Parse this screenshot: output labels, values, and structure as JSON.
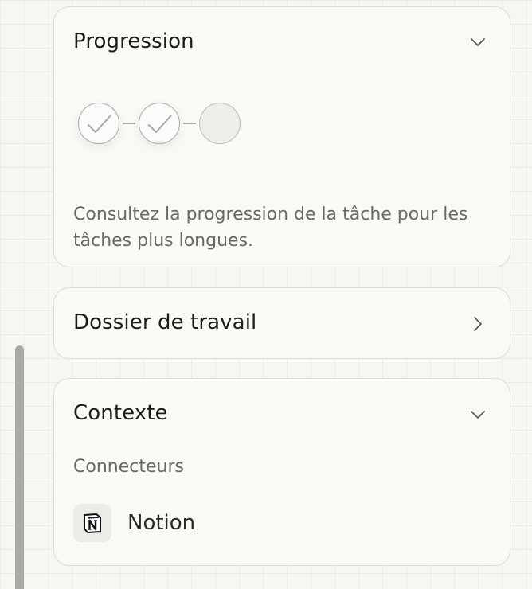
{
  "progression": {
    "title": "Progression",
    "steps": [
      {
        "state": "done",
        "icon": "check-icon"
      },
      {
        "state": "done",
        "icon": "check-icon"
      },
      {
        "state": "pending"
      }
    ],
    "description": "Consultez la progression de la tâche pour les tâches plus longues.",
    "toggle_icon": "chevron-down-icon"
  },
  "work_folder": {
    "title": "Dossier de travail",
    "toggle_icon": "chevron-right-icon"
  },
  "context": {
    "title": "Contexte",
    "toggle_icon": "chevron-down-icon",
    "connectors_label": "Connecteurs",
    "connectors": [
      {
        "name": "Notion",
        "icon": "notion-icon"
      }
    ]
  },
  "colors": {
    "background": "#f7f6f1",
    "card": "#faf9f5",
    "muted_text": "#6a6862"
  }
}
